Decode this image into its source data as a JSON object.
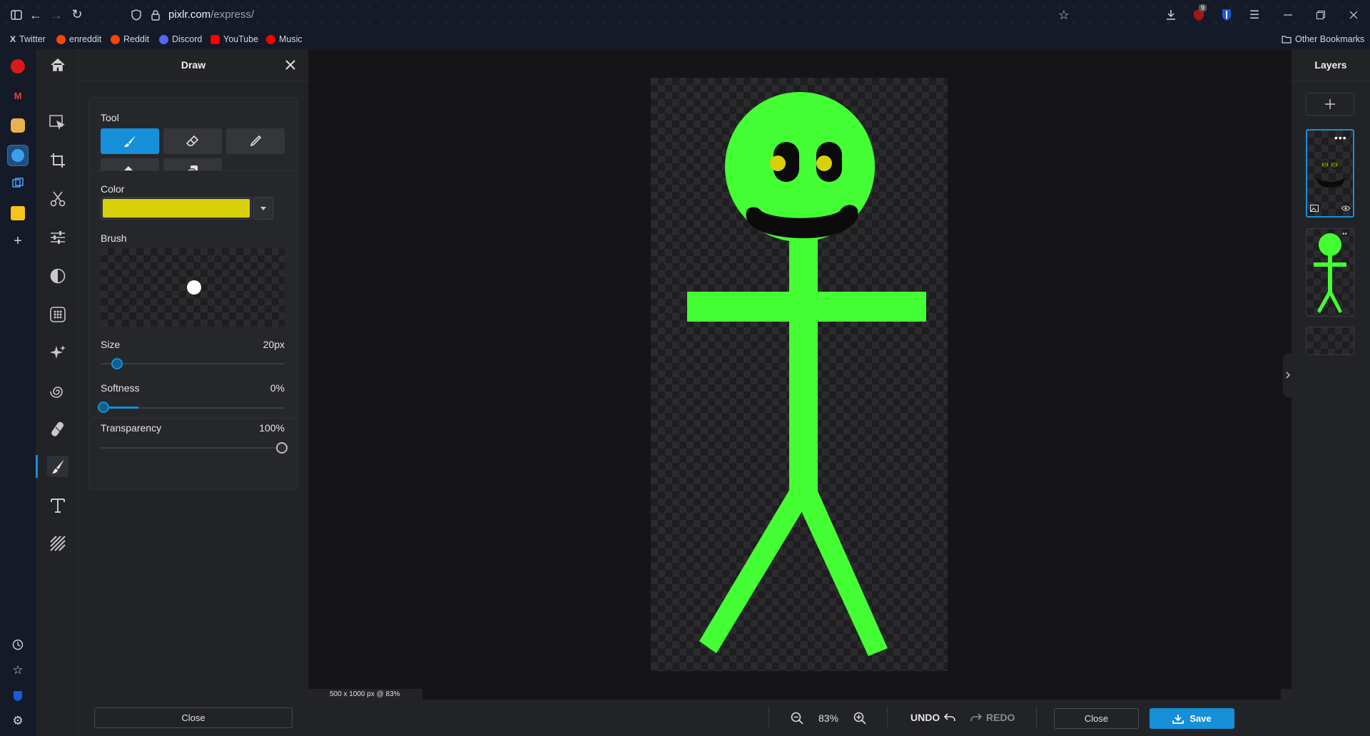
{
  "browser": {
    "url_host": "pixlr.com",
    "url_path": "/express/",
    "badge_count": "9",
    "bookmarks": [
      {
        "label": "Twitter",
        "color": "#ffffff"
      },
      {
        "label": "enreddit",
        "color": "#ff4500"
      },
      {
        "label": "Reddit",
        "color": "#ff4500"
      },
      {
        "label": "Discord",
        "color": "#5865f2"
      },
      {
        "label": "YouTube",
        "color": "#ff0000"
      },
      {
        "label": "Music",
        "color": "#ff0000"
      }
    ],
    "other_bookmarks": "Other Bookmarks"
  },
  "draw_panel": {
    "title": "Draw",
    "tool_label": "Tool",
    "color_label": "Color",
    "color_value": "#d8d10a",
    "brush_label": "Brush",
    "size_label": "Size",
    "size_value": "20px",
    "size_fraction": 0.1,
    "softness_label": "Softness",
    "softness_value": "0%",
    "transparency_label": "Transparency",
    "transparency_value": "100%",
    "close_label": "Close"
  },
  "canvas": {
    "info": "500 x 1000 px @ 83%",
    "figure_color": "#44ff33",
    "eye_color": "#d8d10a"
  },
  "bottom": {
    "zoom": "83%",
    "undo": "UNDO",
    "redo": "REDO",
    "close": "Close",
    "save": "Save"
  },
  "layers": {
    "title": "Layers"
  },
  "colors": {
    "accent": "#1590d8"
  }
}
